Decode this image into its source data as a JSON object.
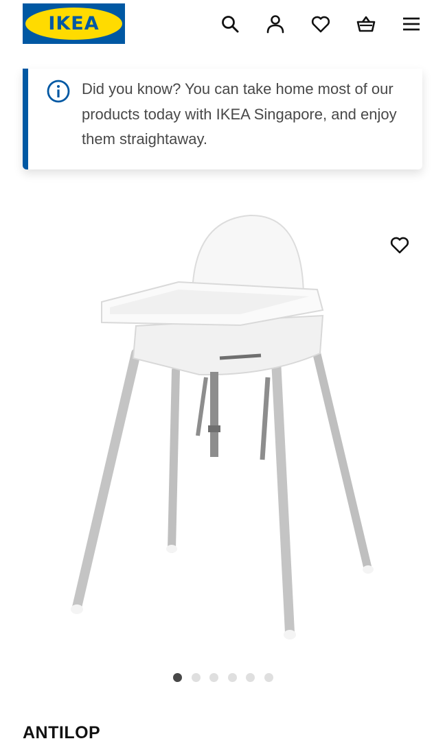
{
  "header": {
    "logo_text": "IKEA",
    "logo_mark": "®",
    "icons": [
      "search-icon",
      "profile-icon",
      "heart-icon",
      "basket-icon",
      "menu-icon"
    ]
  },
  "notice": {
    "icon": "info-icon",
    "text": "Did you know? You can take home most of our products today with IKEA Singapore, and enjoy them straightaway."
  },
  "product": {
    "image_icon": "product-image",
    "favourite_icon": "heart-icon",
    "name": "ANTILOP",
    "carousel": {
      "total": 6,
      "active": 1
    }
  },
  "colors": {
    "brand_blue": "#0058a3",
    "brand_yellow": "#ffdb00",
    "text_dark": "#111111",
    "text_body": "#484848",
    "dot_inactive": "#dfdfdf"
  }
}
